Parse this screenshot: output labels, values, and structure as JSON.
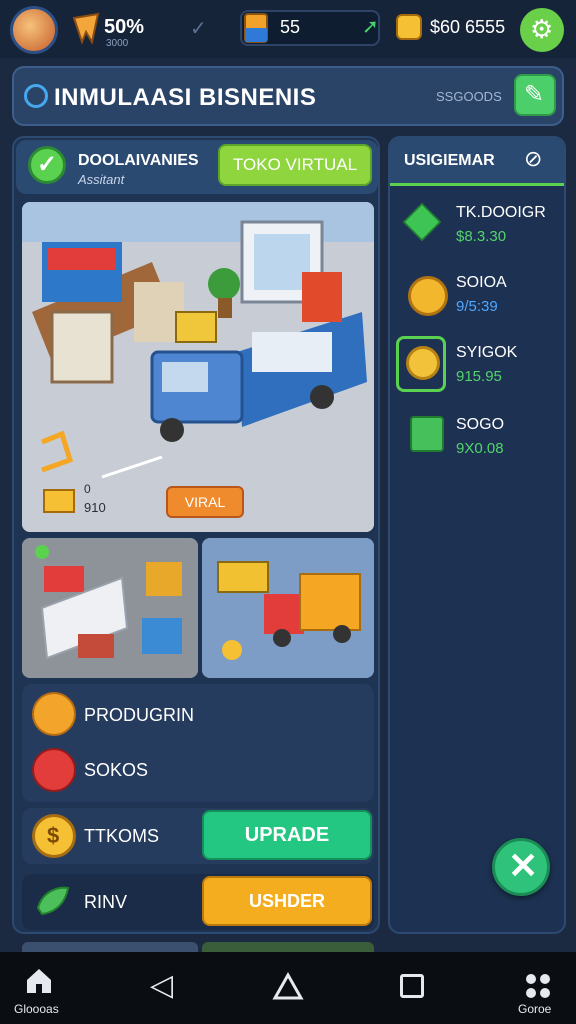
{
  "topbar": {
    "energy": "50%",
    "energy_sub": "3000",
    "gems": "55",
    "coins": "$60 6555"
  },
  "header": {
    "title": "INMULAASI BISNENIS",
    "stat": "SSGOODS"
  },
  "mission": {
    "title": "DOOLAIVANIES",
    "subtitle": "Assitant",
    "button_label": "TOKO VIRTUAL"
  },
  "scene": {
    "tag": "VIRAL",
    "coin_label": "0",
    "coin_value": "910"
  },
  "list": {
    "items": [
      {
        "label": "PRODUGRIN",
        "icon": "tag-icon"
      },
      {
        "label": "SOKOS",
        "icon": "box-icon"
      }
    ]
  },
  "actions": {
    "upgrade_row_label": "TTKOMS",
    "upgrade_button": "UPRADE",
    "buy_row_label": "RINV",
    "buy_button": "USHDER"
  },
  "right_panel": {
    "title": "USIGIEMAR",
    "items": [
      {
        "name": "TK.DOOIGR",
        "value": "$8.3.30",
        "icon": "cube-icon"
      },
      {
        "name": "SOIOA",
        "value": "9/5:39",
        "icon": "coins-icon"
      },
      {
        "name": "SYIGOK",
        "value": "915.95",
        "icon": "coin-stack-icon"
      },
      {
        "name": "SOGO",
        "value": "9X0.08",
        "icon": "basket-icon"
      }
    ]
  },
  "navbar": {
    "home_label": "Gloooas",
    "more_label": "Goroe"
  },
  "colors": {
    "background": "#1b2a40",
    "accent_green": "#5ad14f",
    "upgrade_green": "#23c781",
    "buy_orange": "#f5ad20"
  }
}
